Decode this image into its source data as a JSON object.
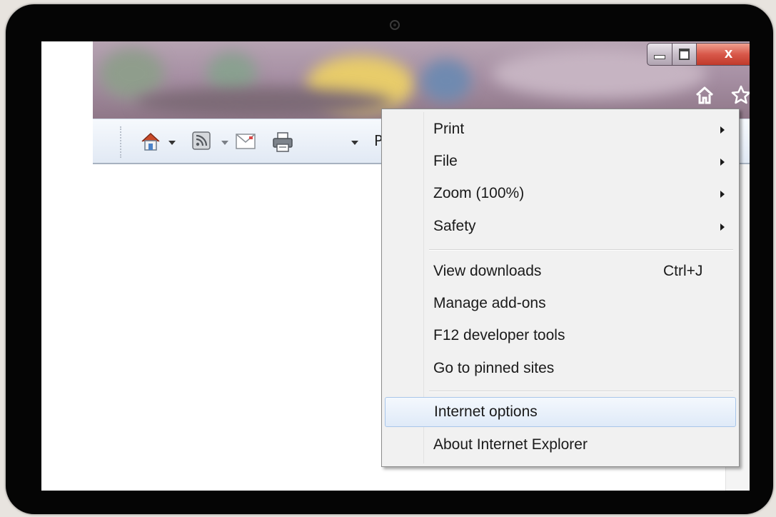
{
  "toolbar": {
    "page_label_partial": "P",
    "close_glyph": "X"
  },
  "menu": {
    "items": [
      {
        "label": "Print",
        "submenu": true
      },
      {
        "label": "File",
        "submenu": true
      },
      {
        "label": "Zoom (100%)",
        "submenu": true
      },
      {
        "label": "Safety",
        "submenu": true
      },
      {
        "label": "View downloads",
        "shortcut": "Ctrl+J"
      },
      {
        "label": "Manage add-ons"
      },
      {
        "label": "F12 developer tools"
      },
      {
        "label": "Go to pinned sites"
      },
      {
        "label": "Internet options",
        "highlighted": true
      },
      {
        "label": "About Internet Explorer"
      }
    ]
  },
  "colors": {
    "menu_background": "#f1f1f1",
    "highlight_border": "#a8c6ea",
    "gear_icon": "#2f8fd8",
    "close_button": "#d8584a"
  },
  "icons": [
    "home-icon",
    "star-icon",
    "gear-icon",
    "home-cmd-icon",
    "rss-feed-icon",
    "mail-icon",
    "printer-icon"
  ]
}
